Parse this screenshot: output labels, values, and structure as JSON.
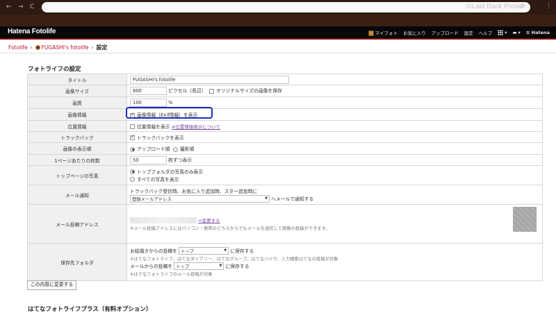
{
  "browser": {
    "back": "←",
    "forward": "→",
    "reload": "C",
    "watermark": "©Laid Back Picnic"
  },
  "header": {
    "logo": "Hatena Fotolife",
    "links": [
      "マイフォト",
      "お気に入り",
      "アップロード",
      "設定",
      "ヘルプ"
    ],
    "brand": "Hatena"
  },
  "breadcrumb": {
    "root": "Fotolife",
    "user": "FUGASHI's fotolife",
    "current": "設定"
  },
  "section_title": "フォトライフの設定",
  "rows": {
    "title": {
      "label": "タイトル",
      "value": "FUGASHI's fotolife"
    },
    "image_size": {
      "label": "画像サイズ",
      "value": "800",
      "unit": "ピクセル（長辺）",
      "save_original": "オリジナルサイズの画像を保存"
    },
    "quality": {
      "label": "画質",
      "value": "100",
      "unit": "%"
    },
    "image_info": {
      "label": "画像情報",
      "checkbox": "画像情報（Exif情報）を表示"
    },
    "location": {
      "label": "位置情報",
      "checkbox": "位置情報を表示",
      "link": "※位置情報表示について"
    },
    "trackback": {
      "label": "トラックバック",
      "checkbox": "トラックバックを表示"
    },
    "display_order": {
      "label": "画像の表示順",
      "option1": "アップロード順",
      "option2": "撮影順"
    },
    "per_page": {
      "label": "1ページあたりの枚数",
      "value": "50",
      "unit": "枚ずつ表示"
    },
    "top_page": {
      "label": "トップページの写真",
      "option1": "トップフォルダの写真のみ表示",
      "option2": "すべての写真を表示"
    },
    "mail_notify": {
      "label": "メール通知",
      "desc": "トラックバック受信時、お気に入り追加時、スター追加時に",
      "select": "登録メールアドレス",
      "suffix": "へメールで通知する"
    },
    "mail_post": {
      "label": "メール投稿アドレス",
      "change_link": "変更する",
      "note": "※メール投稿アドレスにはパソコン・携帯のどちらからでもメールを送信して画像の投稿ができます。"
    },
    "save_folder": {
      "label": "保存先フォルダ",
      "line1_prefix": "お絵描きからの投稿を",
      "line1_select": "トップ",
      "line1_suffix": "に保存する",
      "note1": "※はてなフォトライフ、はてなダイアリー、はてなグループ、はてなハイク、人力検索はてなの投稿が対象",
      "line2_prefix": "メールからの投稿を",
      "line2_select": "トップ",
      "line2_suffix": "に保存する",
      "note2": "※はてなフォトライフのメール投稿が対象"
    }
  },
  "submit": "この内容に変更する",
  "section_title2": "はてなフォトライフプラス（有料オプション）"
}
